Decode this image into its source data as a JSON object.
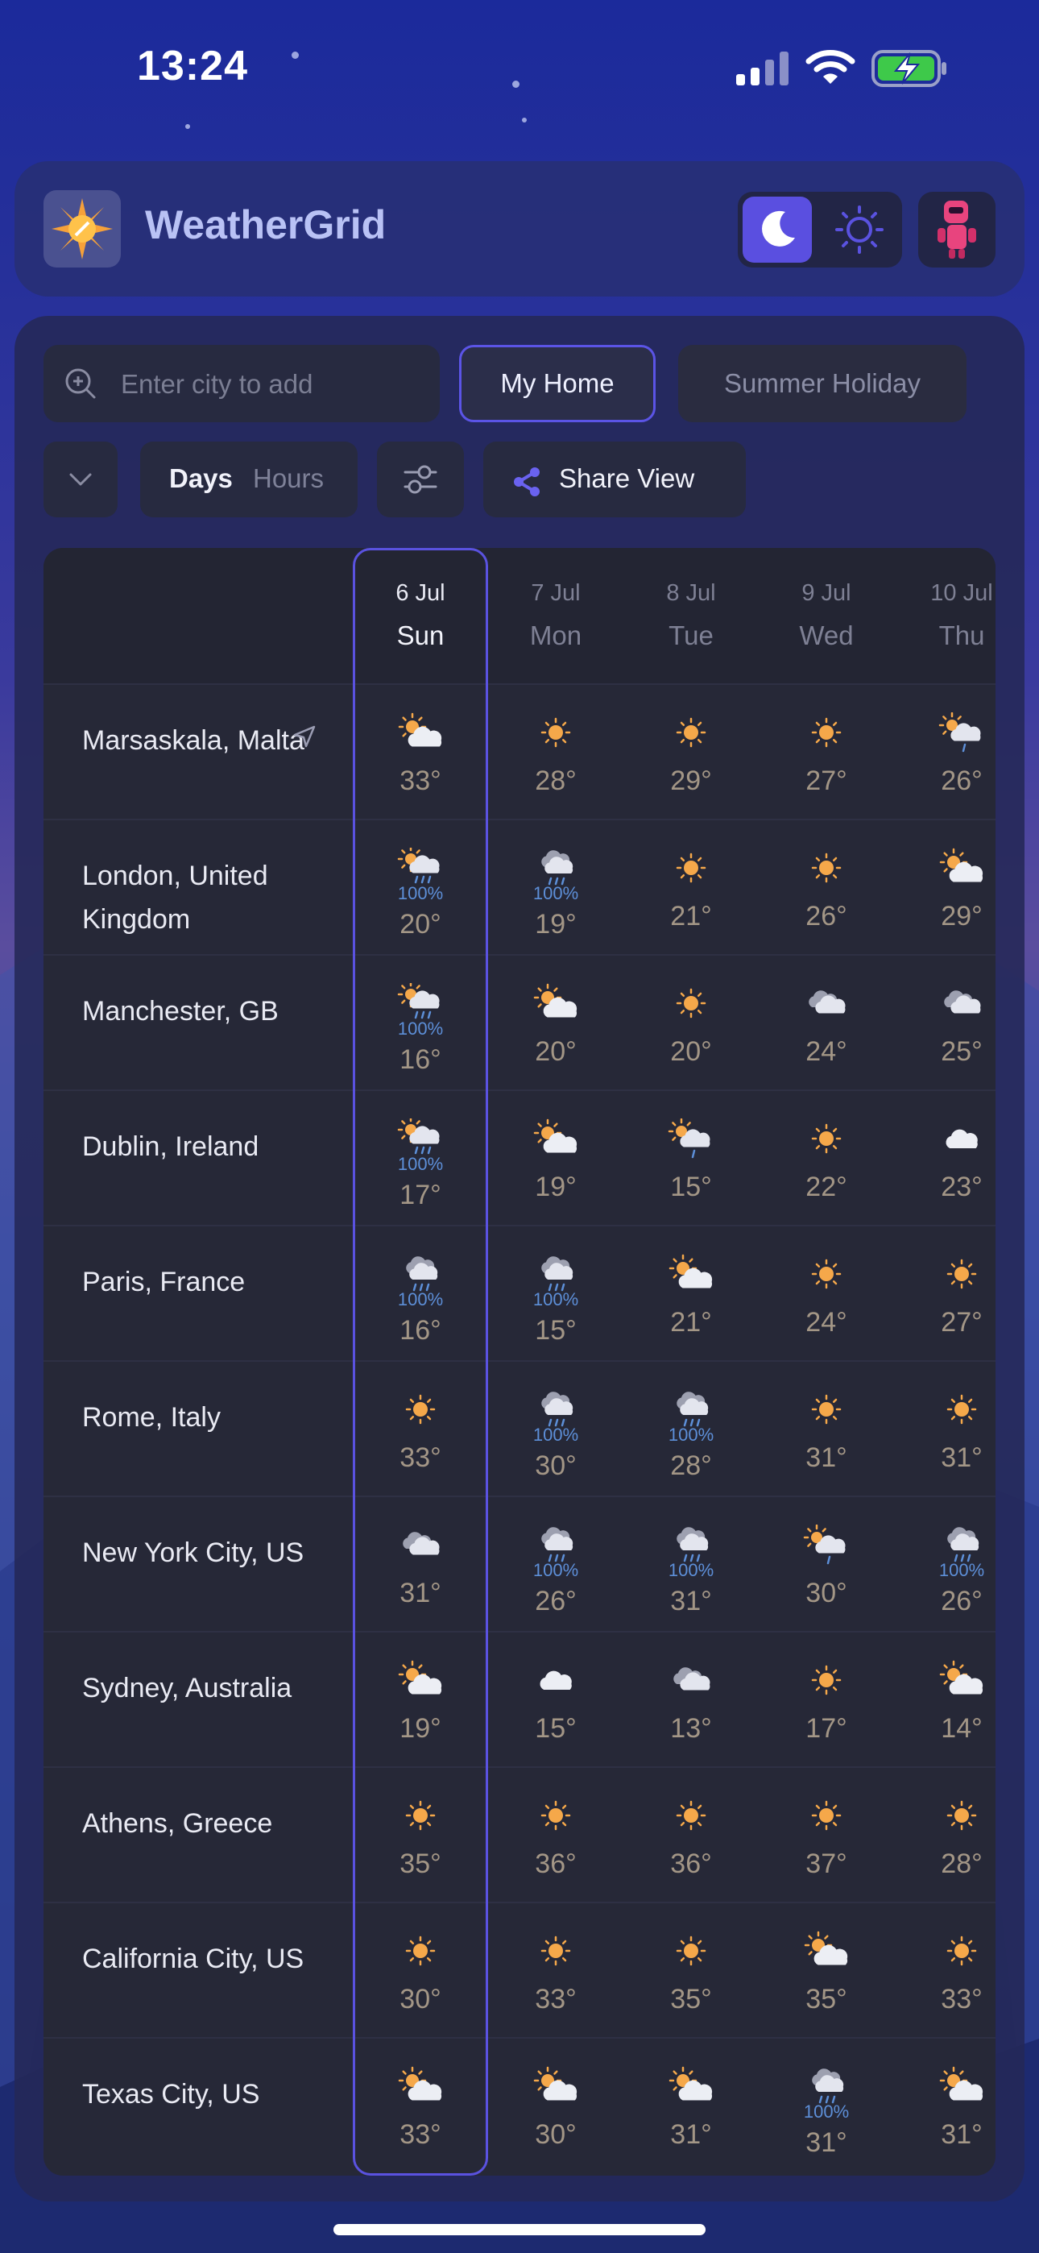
{
  "status_bar": {
    "time": "13:24"
  },
  "header": {
    "app_title": "WeatherGrid",
    "theme_mode": "dark",
    "icons": {
      "logo": "sun-compass-logo",
      "dark_mode": "moon-icon",
      "light_mode": "sun-icon",
      "avatar": "robot-avatar"
    }
  },
  "search": {
    "placeholder": "Enter city to add",
    "value": ""
  },
  "views": [
    {
      "label": "My Home",
      "selected": true
    },
    {
      "label": "Summer Holiday",
      "selected": false
    }
  ],
  "toolbar": {
    "days_label": "Days",
    "hours_label": "Hours",
    "selected_mode": "Days",
    "share_label": "Share View"
  },
  "colors": {
    "accent": "#5a52e0",
    "sun": "#f5a84a",
    "rain_chance": "#5d8fd8",
    "temperature": "#a39686"
  },
  "days": [
    {
      "date": "6 Jul",
      "weekday": "Sun",
      "selected": true
    },
    {
      "date": "7 Jul",
      "weekday": "Mon",
      "selected": false
    },
    {
      "date": "8 Jul",
      "weekday": "Tue",
      "selected": false
    },
    {
      "date": "9 Jul",
      "weekday": "Wed",
      "selected": false
    },
    {
      "date": "10 Jul",
      "weekday": "Thu",
      "selected": false
    }
  ],
  "cities": [
    {
      "name": "Marsaskala, Malta",
      "current_location": true,
      "forecast": [
        {
          "icon": "partly-cloudy",
          "rain": "",
          "temp": "33°"
        },
        {
          "icon": "sunny",
          "rain": "",
          "temp": "28°"
        },
        {
          "icon": "sunny",
          "rain": "",
          "temp": "29°"
        },
        {
          "icon": "sunny",
          "rain": "",
          "temp": "27°"
        },
        {
          "icon": "sun-cloud-drizzle",
          "rain": "",
          "temp": "26°"
        }
      ]
    },
    {
      "name": "London, United Kingdom",
      "current_location": false,
      "forecast": [
        {
          "icon": "sun-cloud-rain",
          "rain": "100%",
          "temp": "20°"
        },
        {
          "icon": "cloud-rain",
          "rain": "100%",
          "temp": "19°"
        },
        {
          "icon": "sunny",
          "rain": "",
          "temp": "21°"
        },
        {
          "icon": "sunny",
          "rain": "",
          "temp": "26°"
        },
        {
          "icon": "partly-cloudy",
          "rain": "",
          "temp": "29°"
        }
      ]
    },
    {
      "name": "Manchester, GB",
      "current_location": false,
      "forecast": [
        {
          "icon": "sun-cloud-rain",
          "rain": "100%",
          "temp": "16°"
        },
        {
          "icon": "partly-cloudy",
          "rain": "",
          "temp": "20°"
        },
        {
          "icon": "sunny",
          "rain": "",
          "temp": "20°"
        },
        {
          "icon": "cloudy",
          "rain": "",
          "temp": "24°"
        },
        {
          "icon": "cloudy",
          "rain": "",
          "temp": "25°"
        }
      ]
    },
    {
      "name": "Dublin, Ireland",
      "current_location": false,
      "forecast": [
        {
          "icon": "sun-cloud-rain",
          "rain": "100%",
          "temp": "17°"
        },
        {
          "icon": "partly-cloudy",
          "rain": "",
          "temp": "19°"
        },
        {
          "icon": "sun-cloud-drizzle",
          "rain": "",
          "temp": "15°"
        },
        {
          "icon": "sunny",
          "rain": "",
          "temp": "22°"
        },
        {
          "icon": "cloud",
          "rain": "",
          "temp": "23°"
        }
      ]
    },
    {
      "name": "Paris, France",
      "current_location": false,
      "forecast": [
        {
          "icon": "cloud-rain",
          "rain": "100%",
          "temp": "16°"
        },
        {
          "icon": "cloud-rain",
          "rain": "100%",
          "temp": "15°"
        },
        {
          "icon": "partly-cloudy",
          "rain": "",
          "temp": "21°"
        },
        {
          "icon": "sunny",
          "rain": "",
          "temp": "24°"
        },
        {
          "icon": "sunny",
          "rain": "",
          "temp": "27°"
        }
      ]
    },
    {
      "name": "Rome, Italy",
      "current_location": false,
      "forecast": [
        {
          "icon": "sunny",
          "rain": "",
          "temp": "33°"
        },
        {
          "icon": "cloud-rain",
          "rain": "100%",
          "temp": "30°"
        },
        {
          "icon": "cloud-rain",
          "rain": "100%",
          "temp": "28°"
        },
        {
          "icon": "sunny",
          "rain": "",
          "temp": "31°"
        },
        {
          "icon": "sunny",
          "rain": "",
          "temp": "31°"
        }
      ]
    },
    {
      "name": "New York City, US",
      "current_location": false,
      "forecast": [
        {
          "icon": "cloudy",
          "rain": "",
          "temp": "31°"
        },
        {
          "icon": "cloud-rain",
          "rain": "100%",
          "temp": "26°"
        },
        {
          "icon": "cloud-rain",
          "rain": "100%",
          "temp": "31°"
        },
        {
          "icon": "sun-cloud-drizzle",
          "rain": "",
          "temp": "30°"
        },
        {
          "icon": "cloud-rain",
          "rain": "100%",
          "temp": "26°"
        }
      ]
    },
    {
      "name": "Sydney, Australia",
      "current_location": false,
      "forecast": [
        {
          "icon": "partly-cloudy",
          "rain": "",
          "temp": "19°"
        },
        {
          "icon": "cloud",
          "rain": "",
          "temp": "15°"
        },
        {
          "icon": "cloudy",
          "rain": "",
          "temp": "13°"
        },
        {
          "icon": "sunny",
          "rain": "",
          "temp": "17°"
        },
        {
          "icon": "partly-cloudy",
          "rain": "",
          "temp": "14°"
        }
      ]
    },
    {
      "name": "Athens, Greece",
      "current_location": false,
      "forecast": [
        {
          "icon": "sunny",
          "rain": "",
          "temp": "35°"
        },
        {
          "icon": "sunny",
          "rain": "",
          "temp": "36°"
        },
        {
          "icon": "sunny",
          "rain": "",
          "temp": "36°"
        },
        {
          "icon": "sunny",
          "rain": "",
          "temp": "37°"
        },
        {
          "icon": "sunny",
          "rain": "",
          "temp": "28°"
        }
      ]
    },
    {
      "name": "California City, US",
      "current_location": false,
      "forecast": [
        {
          "icon": "sunny",
          "rain": "",
          "temp": "30°"
        },
        {
          "icon": "sunny",
          "rain": "",
          "temp": "33°"
        },
        {
          "icon": "sunny",
          "rain": "",
          "temp": "35°"
        },
        {
          "icon": "partly-cloudy",
          "rain": "",
          "temp": "35°"
        },
        {
          "icon": "sunny",
          "rain": "",
          "temp": "33°"
        }
      ]
    },
    {
      "name": "Texas City, US",
      "current_location": false,
      "forecast": [
        {
          "icon": "partly-cloudy",
          "rain": "",
          "temp": "33°"
        },
        {
          "icon": "partly-cloudy",
          "rain": "",
          "temp": "30°"
        },
        {
          "icon": "partly-cloudy",
          "rain": "",
          "temp": "31°"
        },
        {
          "icon": "cloud-rain",
          "rain": "100%",
          "temp": "31°"
        },
        {
          "icon": "partly-cloudy",
          "rain": "",
          "temp": "31°"
        }
      ]
    }
  ]
}
